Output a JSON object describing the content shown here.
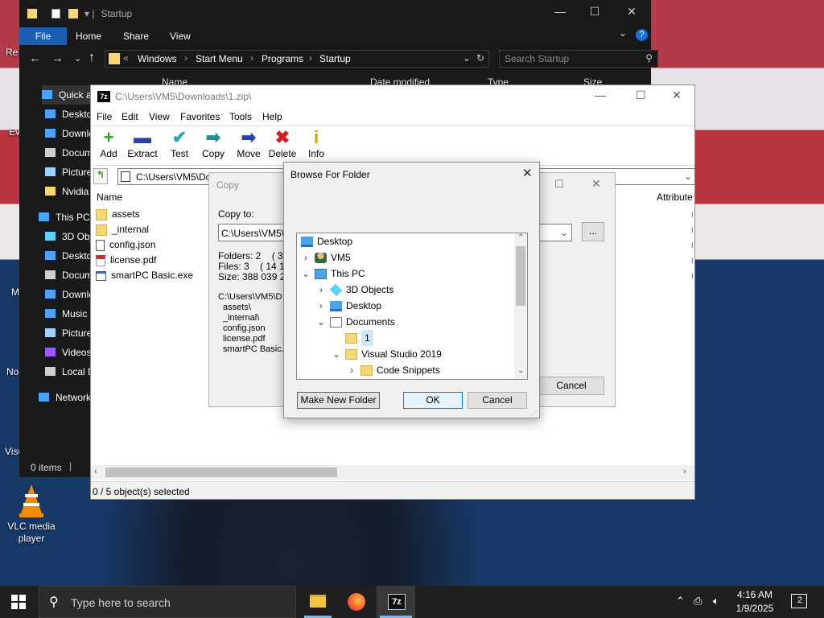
{
  "desktop": {
    "icons": [
      {
        "name": "VLC media\nplayer",
        "label": "VLC media player"
      }
    ],
    "partial_labels": [
      "Re",
      "Ev",
      "M",
      "No",
      "Visu"
    ]
  },
  "explorer": {
    "title": "Startup",
    "ribbon_tabs": [
      "File",
      "Home",
      "Share",
      "View"
    ],
    "address_chevron": "«",
    "breadcrumb": [
      "Windows",
      "Start Menu",
      "Programs",
      "Startup"
    ],
    "search_placeholder": "Search Startup",
    "columns": [
      "Name",
      "Date modified",
      "Type",
      "Size"
    ],
    "nav": [
      {
        "label": "Quick access",
        "icon": "star"
      },
      {
        "label": "Desktop",
        "icon": "desktop"
      },
      {
        "label": "Downloads",
        "icon": "download"
      },
      {
        "label": "Documents",
        "icon": "doc"
      },
      {
        "label": "Pictures",
        "icon": "pic"
      },
      {
        "label": "Nvidia",
        "icon": "folder"
      },
      {
        "label": "This PC",
        "icon": "pc"
      },
      {
        "label": "3D Objects",
        "icon": "3d"
      },
      {
        "label": "Desktop",
        "icon": "desktop"
      },
      {
        "label": "Documents",
        "icon": "doc"
      },
      {
        "label": "Downloads",
        "icon": "download"
      },
      {
        "label": "Music",
        "icon": "music"
      },
      {
        "label": "Pictures",
        "icon": "pic"
      },
      {
        "label": "Videos",
        "icon": "video"
      },
      {
        "label": "Local Disk",
        "icon": "disk"
      },
      {
        "label": "Network",
        "icon": "network"
      }
    ],
    "status": "0 items"
  },
  "zip": {
    "title": "C:\\Users\\VM5\\Downloads\\1.zip\\",
    "menu": [
      "File",
      "Edit",
      "View",
      "Favorites",
      "Tools",
      "Help"
    ],
    "tools": [
      {
        "label": "Add",
        "icon": "+",
        "color": "#2e9e2e"
      },
      {
        "label": "Extract",
        "icon": "▬",
        "color": "#2b3fb0"
      },
      {
        "label": "Test",
        "icon": "✔",
        "color": "#20a8b8"
      },
      {
        "label": "Copy",
        "icon": "➡",
        "color": "#20908a"
      },
      {
        "label": "Move",
        "icon": "➡",
        "color": "#2b3fb0"
      },
      {
        "label": "Delete",
        "icon": "✖",
        "color": "#d02020"
      },
      {
        "label": "Info",
        "icon": "i",
        "color": "#c8a800"
      }
    ],
    "path": "C:\\Users\\VM5\\Do",
    "col_name": "Name",
    "col_attr": "Attribute",
    "files": [
      {
        "name": "assets",
        "type": "folder"
      },
      {
        "name": "_internal",
        "type": "folder"
      },
      {
        "name": "config.json",
        "type": "file"
      },
      {
        "name": "license.pdf",
        "type": "pdf"
      },
      {
        "name": "smartPC Basic.exe",
        "type": "exe"
      }
    ],
    "status": "0 / 5 object(s) selected"
  },
  "copy": {
    "title": "Copy",
    "copy_to": "Copy to:",
    "path_value": "C:\\Users\\VM5\\D",
    "browse_btn": "...",
    "folders": "Folders: 2    ( 373",
    "files": "Files: 3    ( 14 16",
    "size": "Size: 388 039 21",
    "list_head": "C:\\Users\\VM5\\D",
    "list": [
      "assets\\",
      "_internal\\",
      "config.json",
      "license.pdf",
      "smartPC Basic.e"
    ],
    "cancel": "Cancel"
  },
  "browse": {
    "title": "Browse For Folder",
    "tree": [
      {
        "label": "Desktop",
        "indent": 0,
        "exp": "",
        "icon": "desktop"
      },
      {
        "label": "VM5",
        "indent": 1,
        "exp": "›",
        "icon": "user"
      },
      {
        "label": "This PC",
        "indent": 1,
        "exp": "⌄",
        "icon": "pc"
      },
      {
        "label": "3D Objects",
        "indent": 2,
        "exp": "›",
        "icon": "3d"
      },
      {
        "label": "Desktop",
        "indent": 2,
        "exp": "›",
        "icon": "desktop"
      },
      {
        "label": "Documents",
        "indent": 2,
        "exp": "⌄",
        "icon": "doc"
      },
      {
        "label": "1",
        "indent": 3,
        "exp": "",
        "icon": "folder",
        "selected": true
      },
      {
        "label": "Visual Studio 2019",
        "indent": 3,
        "exp": "⌄",
        "icon": "folder"
      },
      {
        "label": "Code Snippets",
        "indent": 4,
        "exp": "›",
        "icon": "folder"
      }
    ],
    "make_new_folder": "Make New Folder",
    "ok": "OK",
    "cancel": "Cancel"
  },
  "taskbar": {
    "search_placeholder": "Type here to search",
    "time": "4:16 AM",
    "date": "1/9/2025",
    "notification_count": "2",
    "zip_label": "7z"
  }
}
